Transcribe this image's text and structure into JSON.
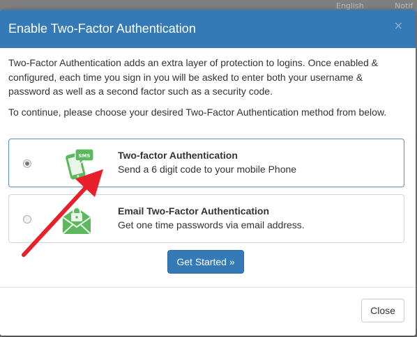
{
  "background_nav": {
    "items": [
      "English",
      "Notif"
    ]
  },
  "modal": {
    "title": "Enable Two-Factor Authentication",
    "close_glyph": "×",
    "intro": "Two-Factor Authentication adds an extra layer of protection to logins. Once enabled & configured, each time you sign in you will be asked to enter both your username & password as well as a second factor such as a security code.",
    "instruction": "To continue, please choose your desired Two-Factor Authentication method from below.",
    "options": [
      {
        "title": "Two-factor Authentication",
        "description": "Send a 6 digit code to your mobile Phone",
        "icon": "sms-phone-icon",
        "selected": true,
        "icon_text": "SMS"
      },
      {
        "title": "Email Two-Factor Authentication",
        "description": "Get one time passwords via email address.",
        "icon": "email-lock-icon",
        "selected": false
      }
    ],
    "primary_button": "Get Started »",
    "footer_button": "Close"
  },
  "colors": {
    "header": "#337ab7",
    "icon_green": "#5cb85c",
    "arrow_red": "#e8202a"
  }
}
